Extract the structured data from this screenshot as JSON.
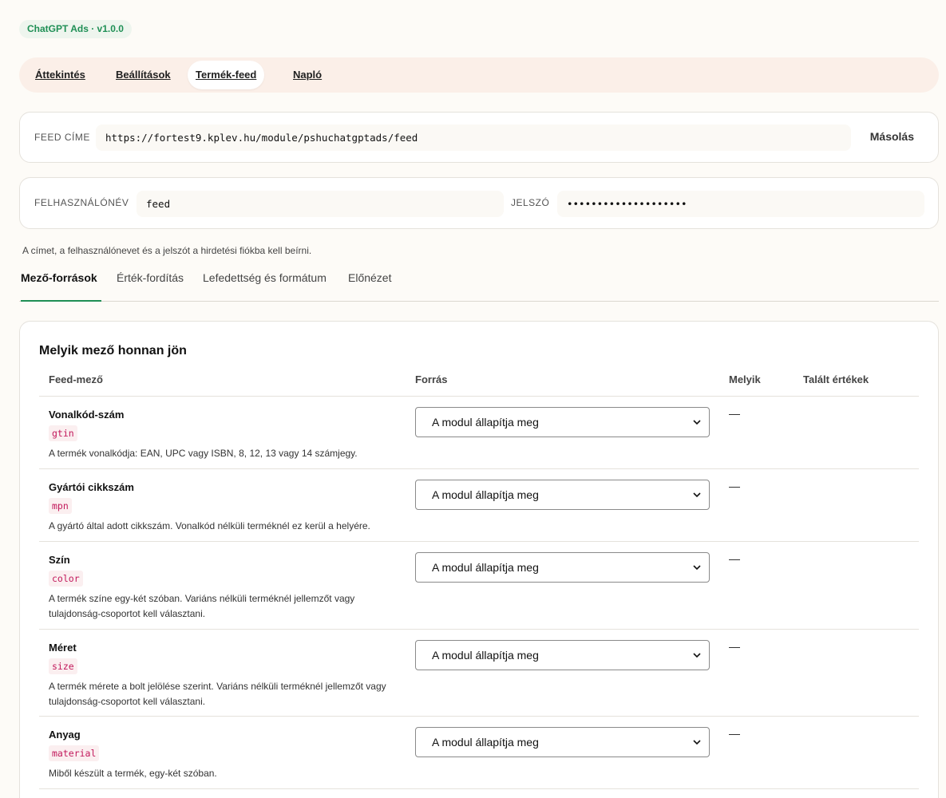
{
  "badge": "ChatGPT Ads · v1.0.0",
  "nav": [
    {
      "label": "Áttekintés"
    },
    {
      "label": "Beállítások"
    },
    {
      "label": "Termék-feed"
    },
    {
      "label": "Napló"
    }
  ],
  "feed": {
    "label": "FEED CÍME",
    "url": "https://fortest9.kplev.hu/module/pshuchatgptads/feed",
    "copy_label": "Másolás"
  },
  "credentials": {
    "username_label": "FELHASZNÁLÓNÉV",
    "username": "feed",
    "password_label": "JELSZÓ",
    "password": "••••••••••••••••••••"
  },
  "hint": "A címet, a felhasználónevet és a jelszót a hirdetési fiókba kell beírni.",
  "subtabs": [
    {
      "label": "Mező-források"
    },
    {
      "label": "Érték-fordítás"
    },
    {
      "label": "Lefedettség és formátum"
    },
    {
      "label": "Előnézet"
    }
  ],
  "section": {
    "title": "Melyik mező honnan jön",
    "headers": {
      "field": "Feed-mező",
      "source": "Forrás",
      "which": "Melyik",
      "found": "Talált értékek"
    }
  },
  "rows": [
    {
      "title": "Vonalkód-szám",
      "code": "gtin",
      "desc": "A termék vonalkódja: EAN, UPC vagy ISBN, 8, 12, 13 vagy 14 számjegy.",
      "select": "A modul állapítja meg",
      "which": "—"
    },
    {
      "title": "Gyártói cikkszám",
      "code": "mpn",
      "desc": "A gyártó által adott cikkszám. Vonalkód nélküli terméknél ez kerül a helyére.",
      "select": "A modul állapítja meg",
      "which": "—"
    },
    {
      "title": "Szín",
      "code": "color",
      "desc": "A termék színe egy-két szóban. Variáns nélküli terméknél jellemzőt vagy tulajdonság-csoportot kell választani.",
      "select": "A modul állapítja meg",
      "which": "—"
    },
    {
      "title": "Méret",
      "code": "size",
      "desc": "A termék mérete a bolt jelölése szerint. Variáns nélküli terméknél jellemzőt vagy tulajdonság-csoportot kell választani.",
      "select": "A modul állapítja meg",
      "which": "—"
    },
    {
      "title": "Anyag",
      "code": "material",
      "desc": "Miből készült a termék, egy-két szóban.",
      "select": "A modul állapítja meg",
      "which": "—"
    }
  ]
}
